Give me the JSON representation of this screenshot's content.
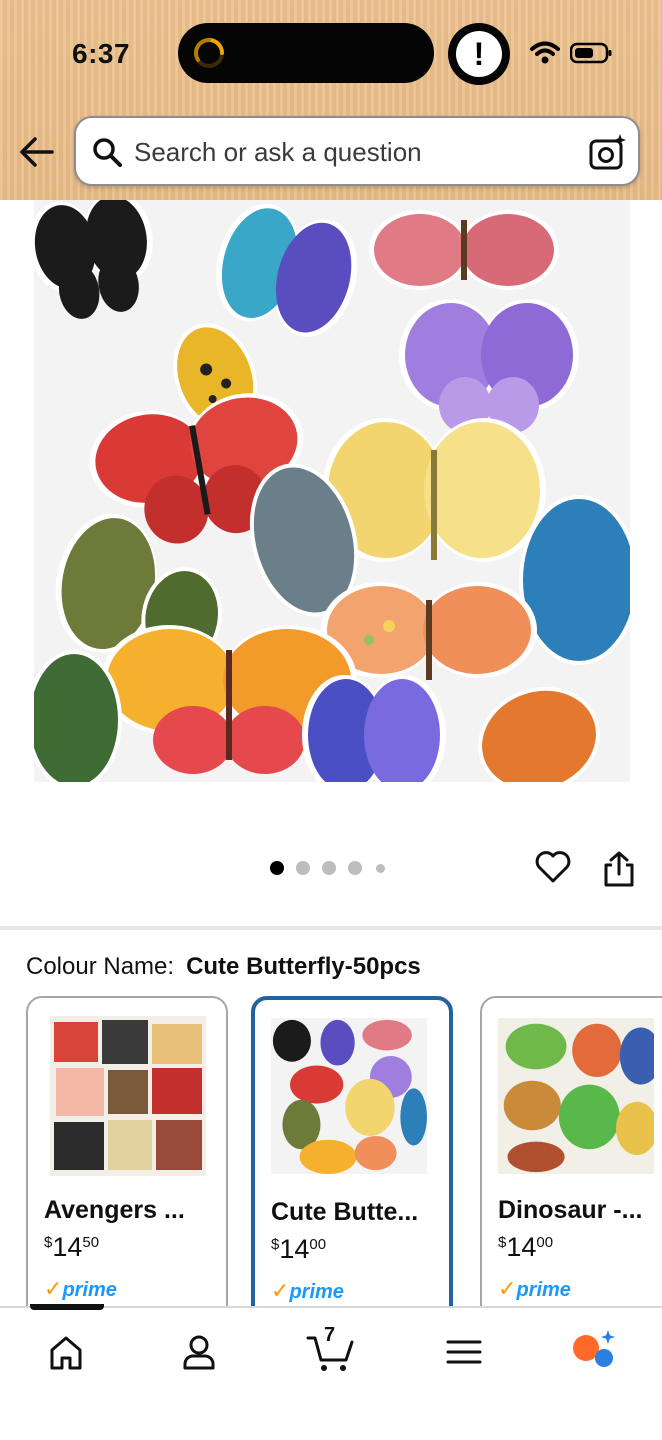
{
  "status_bar": {
    "time": "6:37",
    "alert_glyph": "!"
  },
  "search": {
    "placeholder": "Search or ask a question"
  },
  "carousel": {
    "total_images": 5,
    "active_index": 0
  },
  "colour": {
    "label": "Colour Name:",
    "selected": "Cute Butterfly-50pcs",
    "options": [
      {
        "title": "Avengers ...",
        "price_whole": "14",
        "price_cents": "50",
        "currency": "$",
        "prime_check": "✓",
        "prime_word": "prime"
      },
      {
        "title": "Cute Butte...",
        "price_whole": "14",
        "price_cents": "00",
        "currency": "$",
        "prime_check": "✓",
        "prime_word": "prime"
      },
      {
        "title": "Dinosaur -...",
        "price_whole": "14",
        "price_cents": "00",
        "currency": "$",
        "prime_check": "✓",
        "prime_word": "prime"
      }
    ]
  },
  "nav": {
    "items": [
      "home-icon",
      "account-icon",
      "cart-icon",
      "menu-icon",
      "rufus-icon"
    ],
    "cart_count": "7"
  },
  "colors": {
    "header": "#e8bb86",
    "selected_border": "#2162a1",
    "prime_blue": "#1a98ff",
    "prime_check": "#ff9900"
  }
}
